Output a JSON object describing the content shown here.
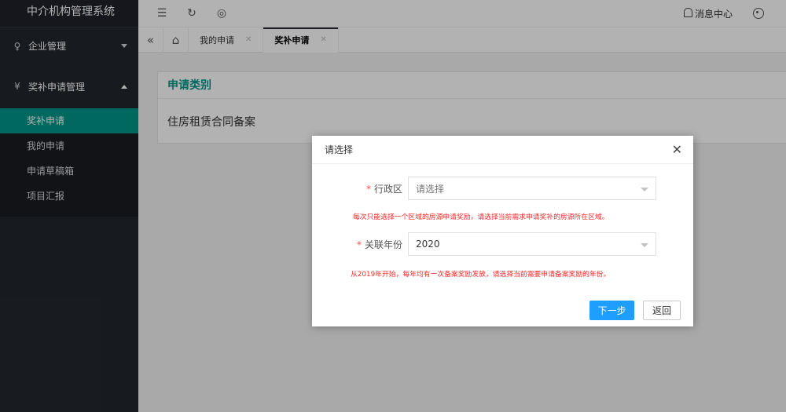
{
  "app": {
    "title": "中介机构管理系统"
  },
  "sidebar": {
    "groups": [
      {
        "label": "企业管理",
        "icon": "user-icon",
        "expanded": false
      },
      {
        "label": "奖补申请管理",
        "icon": "yen-icon",
        "expanded": true,
        "items": [
          {
            "label": "奖补申请",
            "active": true
          },
          {
            "label": "我的申请",
            "active": false
          },
          {
            "label": "申请草稿箱",
            "active": false
          },
          {
            "label": "项目汇报",
            "active": false
          }
        ]
      }
    ]
  },
  "header": {
    "message_center": "消息中心"
  },
  "tabs": [
    {
      "label": "我的申请",
      "active": false
    },
    {
      "label": "奖补申请",
      "active": true
    }
  ],
  "card": {
    "title": "申请类别",
    "value": "住房租赁合同备案"
  },
  "modal": {
    "title": "请选择",
    "fields": [
      {
        "label": "行政区",
        "required": true,
        "placeholder": "请选择",
        "value": "",
        "hint": "每次只能选择一个区域的房源申请奖励，请选择当前需求申请奖补的房源所在区域。"
      },
      {
        "label": "关联年份",
        "required": true,
        "placeholder": "",
        "value": "2020",
        "hint": "从2019年开始，每年均有一次备案奖励发放，请选择当前需要申请备案奖励的年份。"
      }
    ],
    "next_label": "下一步",
    "back_label": "返回"
  },
  "colors": {
    "sidebar_bg": "#22272e",
    "accent": "#009688",
    "primary_button": "#1e9fff",
    "hint_red": "#ff2a2a"
  }
}
